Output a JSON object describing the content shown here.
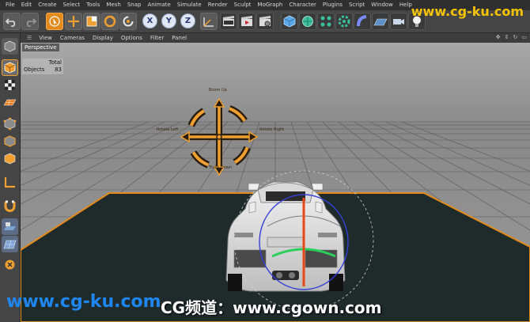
{
  "menubar": {
    "items": [
      "File",
      "Edit",
      "Create",
      "Select",
      "Tools",
      "Mesh",
      "Snap",
      "Animate",
      "Simulate",
      "Render",
      "Sculpt",
      "MoGraph",
      "Character",
      "Plugins",
      "Script",
      "Window",
      "Help"
    ]
  },
  "toolbar": {
    "axis_x": "X",
    "axis_y": "Y",
    "axis_z": "Z"
  },
  "viewport": {
    "menu": [
      "View",
      "Cameras",
      "Display",
      "Options",
      "Filter",
      "Panel"
    ],
    "camera_label": "Perspective",
    "hud": {
      "header": "Total",
      "objects_label": "Objects",
      "objects_value": "83"
    },
    "manipulator": {
      "up": "Boom Up",
      "down": "Truck Down",
      "left": "Rotate Left",
      "right": "Rotate Right"
    }
  },
  "watermarks": {
    "top": "www.cg-ku.com",
    "bottom_left": "www.cg-ku.com",
    "bottom_center": "CG频道：www.cgown.com"
  },
  "colors": {
    "accent_orange": "#e38a1d",
    "floor": "#1f2a2a",
    "viewport_bg": "#9b9b9b"
  }
}
